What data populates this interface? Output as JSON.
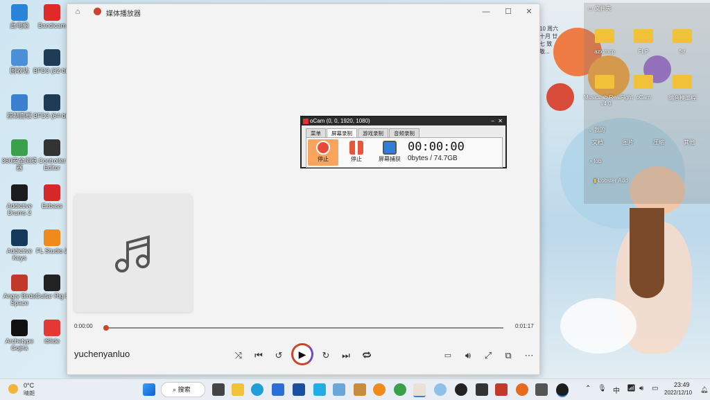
{
  "desktop": {
    "icons": [
      {
        "label": "此电脑",
        "name": "this-pc-icon",
        "color": "#2a83d6"
      },
      {
        "label": "Bandicam",
        "name": "bandicam-icon",
        "color": "#e02a2a"
      },
      {
        "label": "回收站",
        "name": "recycle-bin-icon",
        "color": "#4a90d9"
      },
      {
        "label": "BFD3 (32-bit)",
        "name": "bfd3-32-icon",
        "color": "#1f3c57"
      },
      {
        "label": "控制面板",
        "name": "control-panel-icon",
        "color": "#3a7fd0"
      },
      {
        "label": "BFD3 (64-bit)",
        "name": "bfd3-64-icon",
        "color": "#1f3c57"
      },
      {
        "label": "360安全浏览器",
        "name": "360-browser-icon",
        "color": "#3aa14a"
      },
      {
        "label": "Controller Editor",
        "name": "controller-editor-icon",
        "color": "#333333"
      },
      {
        "label": "Addictive Drums 2",
        "name": "addictive-drums-icon",
        "color": "#1c1c1c"
      },
      {
        "label": "Ezbass",
        "name": "ezbass-icon",
        "color": "#d62828"
      },
      {
        "label": "Addictive Keys",
        "name": "addictive-keys-icon",
        "color": "#163a5c"
      },
      {
        "label": "FL Studio 2",
        "name": "fl-studio-icon",
        "color": "#f08a1c"
      },
      {
        "label": "Angry Birds Space",
        "name": "angry-birds-icon",
        "color": "#c0392b"
      },
      {
        "label": "Guitar Rig 5",
        "name": "guitar-rig-icon",
        "color": "#222222"
      },
      {
        "label": "Archetype Gojira",
        "name": "archetype-gojira-icon",
        "color": "#111111"
      },
      {
        "label": "iSlide",
        "name": "islide-icon",
        "color": "#e53935"
      }
    ]
  },
  "player": {
    "title": "媒体播放器",
    "home_icon": "home-icon",
    "minimize_glyph": "—",
    "maximize_glyph": "☐",
    "close_glyph": "✕",
    "time_current": "0:00:00",
    "time_total": "0:01:17",
    "progress": 0.0,
    "artist": "yuchenyanluo",
    "accent": "#c9462c"
  },
  "ocam": {
    "title": "oCam (0, 0, 1920, 1080)",
    "tabs": [
      "菜单",
      "屏幕录制",
      "游戏录制",
      "音频录制"
    ],
    "active_tab": "屏幕录制",
    "record_label": "停止",
    "pause_label": "停止",
    "capture_label": "屏幕捕获",
    "timer": "00:00:00",
    "size": "0bytes / 74.7GB"
  },
  "explorer": {
    "title": "文件夹",
    "folders": [
      "azxtmcp",
      "FLP",
      "fst",
      "MusicLab.RealFight v4.0",
      "oCam",
      "编音模工程"
    ],
    "section2_title": "我的",
    "tabs": [
      "文档",
      "图片",
      "压缩",
      "其他"
    ],
    "search_value": "lob",
    "result": "Lobster Add"
  },
  "wallpaper_text": "10 周六 十月 廿七 致敬...",
  "taskbar": {
    "weather_temp": "0°C",
    "weather_desc": "晴朗",
    "search_label": "搜索",
    "time": "23:49",
    "date": "2022/12/10",
    "ime": "中"
  }
}
